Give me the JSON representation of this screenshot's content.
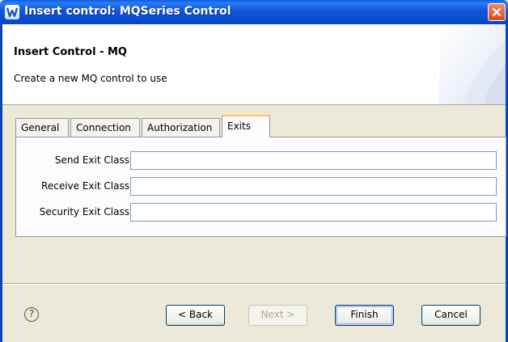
{
  "window": {
    "title": "Insert control: MQSeries Control",
    "app_icon": "workshop-w-icon",
    "close_icon": "close-icon"
  },
  "banner": {
    "title": "Insert Control - MQ",
    "description": "Create a new MQ control to use"
  },
  "tabs": [
    {
      "label": "General",
      "active": false
    },
    {
      "label": "Connection",
      "active": false
    },
    {
      "label": "Authorization",
      "active": false
    },
    {
      "label": "Exits",
      "active": true
    }
  ],
  "fields": [
    {
      "label": "Send Exit Class:",
      "value": ""
    },
    {
      "label": "Receive Exit Class:",
      "value": ""
    },
    {
      "label": "Security Exit Class:",
      "value": ""
    }
  ],
  "footer": {
    "help_symbol": "?",
    "back_label": "< Back",
    "next_label": "Next >",
    "finish_label": "Finish",
    "cancel_label": "Cancel"
  },
  "colors": {
    "titlebar": "#0A4CCB",
    "tab_accent": "#FFC83C",
    "window_bg": "#ECE9D8"
  }
}
